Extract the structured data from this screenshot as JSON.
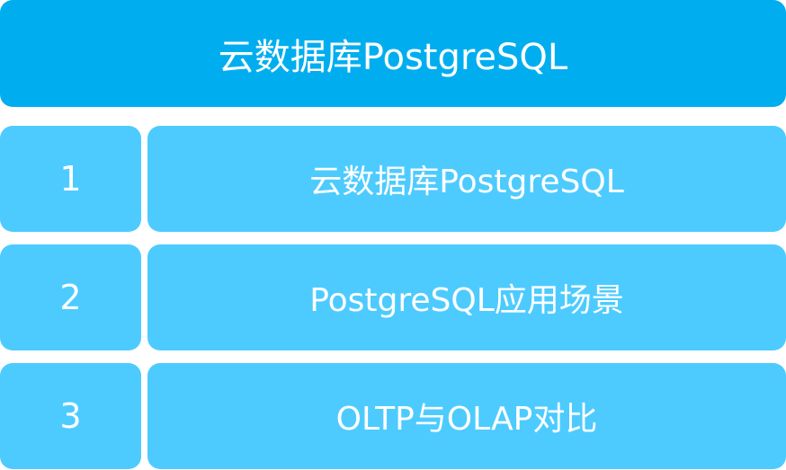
{
  "header": {
    "title": "云数据库PostgreSQL"
  },
  "items": [
    {
      "number": "1",
      "label": "云数据库PostgreSQL"
    },
    {
      "number": "2",
      "label": "PostgreSQL应用场景"
    },
    {
      "number": "3",
      "label": "OLTP与OLAP对比"
    }
  ],
  "colors": {
    "header_bg": "#00aeef",
    "row_bg": "#4dcbff",
    "text": "#ffffff"
  }
}
